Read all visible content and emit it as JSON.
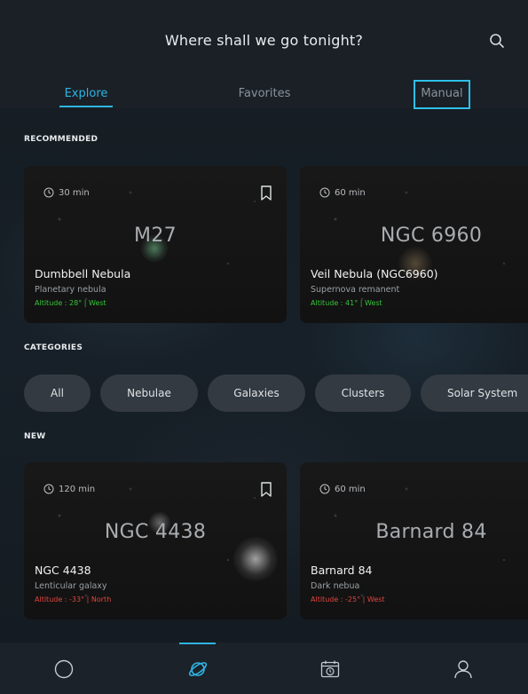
{
  "header": {
    "title": "Where shall we go tonight?",
    "tabs": [
      {
        "label": "Explore",
        "active": true
      },
      {
        "label": "Favorites",
        "active": false
      },
      {
        "label": "Manual",
        "active": false,
        "highlighted": true
      }
    ]
  },
  "sections": {
    "recommended": "RECOMMENDED",
    "categories": "CATEGORIES",
    "new": "NEW"
  },
  "recommended": [
    {
      "time": "30 min",
      "catalog": "M27",
      "name": "Dumbbell Nebula",
      "type": "Planetary nebula",
      "altitude": "Altitude : 28° | West",
      "altitude_color": "#36c43a"
    },
    {
      "time": "60 min",
      "catalog": "NGC 6960",
      "name": "Veil Nebula (NGC6960)",
      "type": "Supernova remanent",
      "altitude": "Altitude : 41° | West",
      "altitude_color": "#36c43a"
    }
  ],
  "categories": [
    "All",
    "Nebulae",
    "Galaxies",
    "Clusters",
    "Solar System"
  ],
  "new": [
    {
      "time": "120 min",
      "catalog": "NGC 4438",
      "name": "NGC 4438",
      "type": "Lenticular galaxy",
      "altitude": "Altitude : -33° | North",
      "altitude_color": "#e0453f"
    },
    {
      "time": "60 min",
      "catalog": "Barnard 84",
      "name": "Barnard 84",
      "type": "Dark nebua",
      "altitude": "Altitude : -25° | West",
      "altitude_color": "#e0453f"
    }
  ],
  "bottom_nav": [
    {
      "icon": "circle-icon",
      "active": false
    },
    {
      "icon": "planet-icon",
      "active": true
    },
    {
      "icon": "calendar-clock-icon",
      "active": false
    },
    {
      "icon": "user-icon",
      "active": false
    }
  ],
  "colors": {
    "accent": "#2fb3e3",
    "background": "#151b21",
    "chip": "#333a41"
  }
}
